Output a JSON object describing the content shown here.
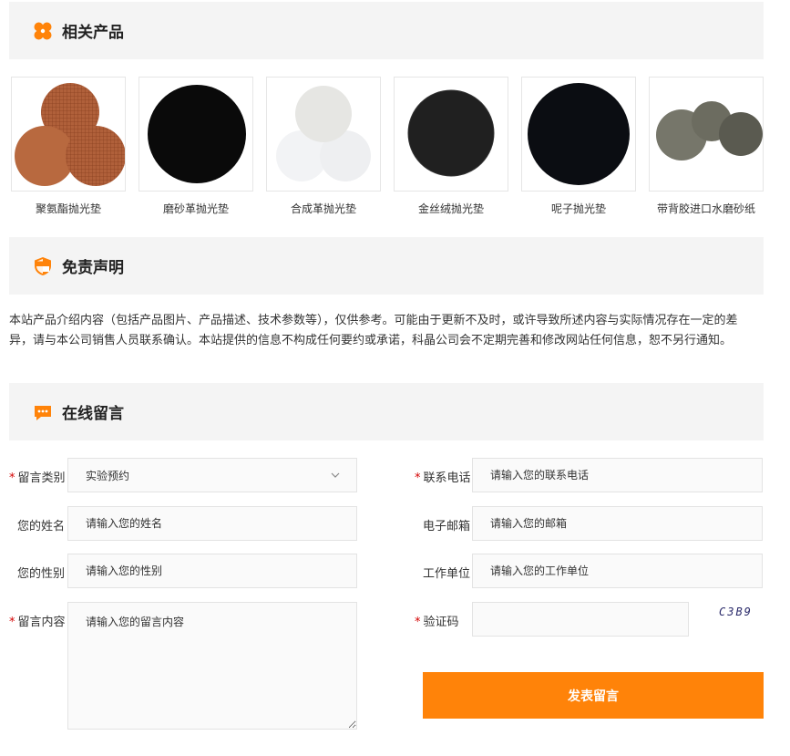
{
  "related": {
    "title": "相关产品",
    "products": [
      {
        "name": "聚氨酯抛光垫"
      },
      {
        "name": "磨砂革抛光垫"
      },
      {
        "name": "合成革抛光垫"
      },
      {
        "name": "金丝绒抛光垫"
      },
      {
        "name": "呢子抛光垫"
      },
      {
        "name": "带背胶进口水磨砂纸"
      }
    ]
  },
  "disclaimer": {
    "title": "免责声明",
    "text": "本站产品介绍内容（包括产品图片、产品描述、技术参数等），仅供参考。可能由于更新不及时，或许导致所述内容与实际情况存在一定的差异，请与本公司销售人员联系确认。本站提供的信息不构成任何要约或承诺，科晶公司会不定期完善和修改网站任何信息，恕不另行通知。"
  },
  "message": {
    "title": "在线留言",
    "required_mark": "*",
    "category": {
      "label": "留言类别",
      "value": "实验预约"
    },
    "phone": {
      "label": "联系电话",
      "placeholder": "请输入您的联系电话"
    },
    "name": {
      "label": "您的姓名",
      "placeholder": "请输入您的姓名"
    },
    "email": {
      "label": "电子邮箱",
      "placeholder": "请输入您的邮箱"
    },
    "gender": {
      "label": "您的性别",
      "placeholder": "请输入您的性别"
    },
    "company": {
      "label": "工作单位",
      "placeholder": "请输入您的工作单位"
    },
    "content": {
      "label": "留言内容",
      "placeholder": "请输入您的留言内容"
    },
    "captcha": {
      "label": "验证码",
      "image_text": "C3B9"
    },
    "submit_label": "发表留言"
  },
  "colors": {
    "accent": "#ff8309",
    "required": "#d40000",
    "section_bg": "#f4f4f4"
  }
}
